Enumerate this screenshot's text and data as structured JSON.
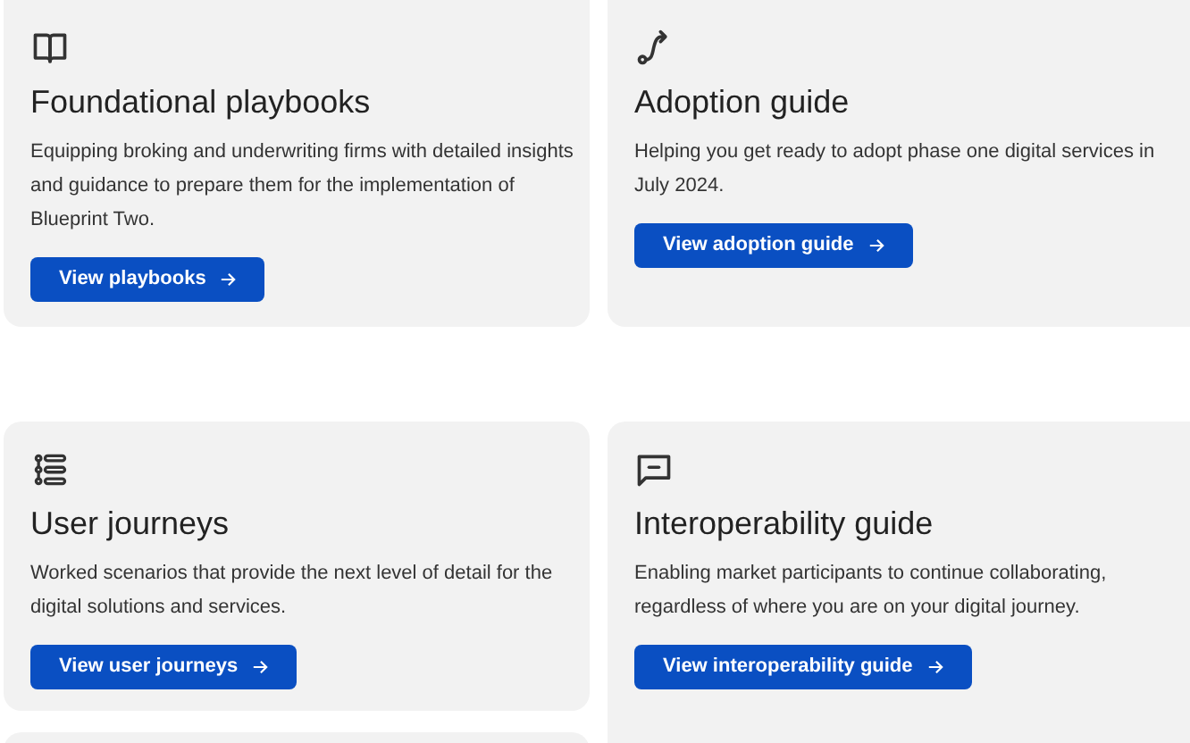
{
  "cards": [
    {
      "title": "Foundational playbooks",
      "description": "Equipping broking and underwriting firms with detailed insights and guidance to prepare them for the implementation of Blueprint Two.",
      "button": "View playbooks"
    },
    {
      "title": "Adoption guide",
      "description": "Helping you get ready to adopt phase one digital services in July 2024.",
      "button": "View adoption guide"
    },
    {
      "title": "User journeys",
      "description": "Worked scenarios that provide the next level of detail for the digital solutions and services.",
      "button": "View user journeys"
    },
    {
      "title": "Interoperability guide",
      "description": "Enabling market participants to continue collaborating, regardless of where you are on your digital journey.",
      "button": "View interoperability guide"
    }
  ]
}
